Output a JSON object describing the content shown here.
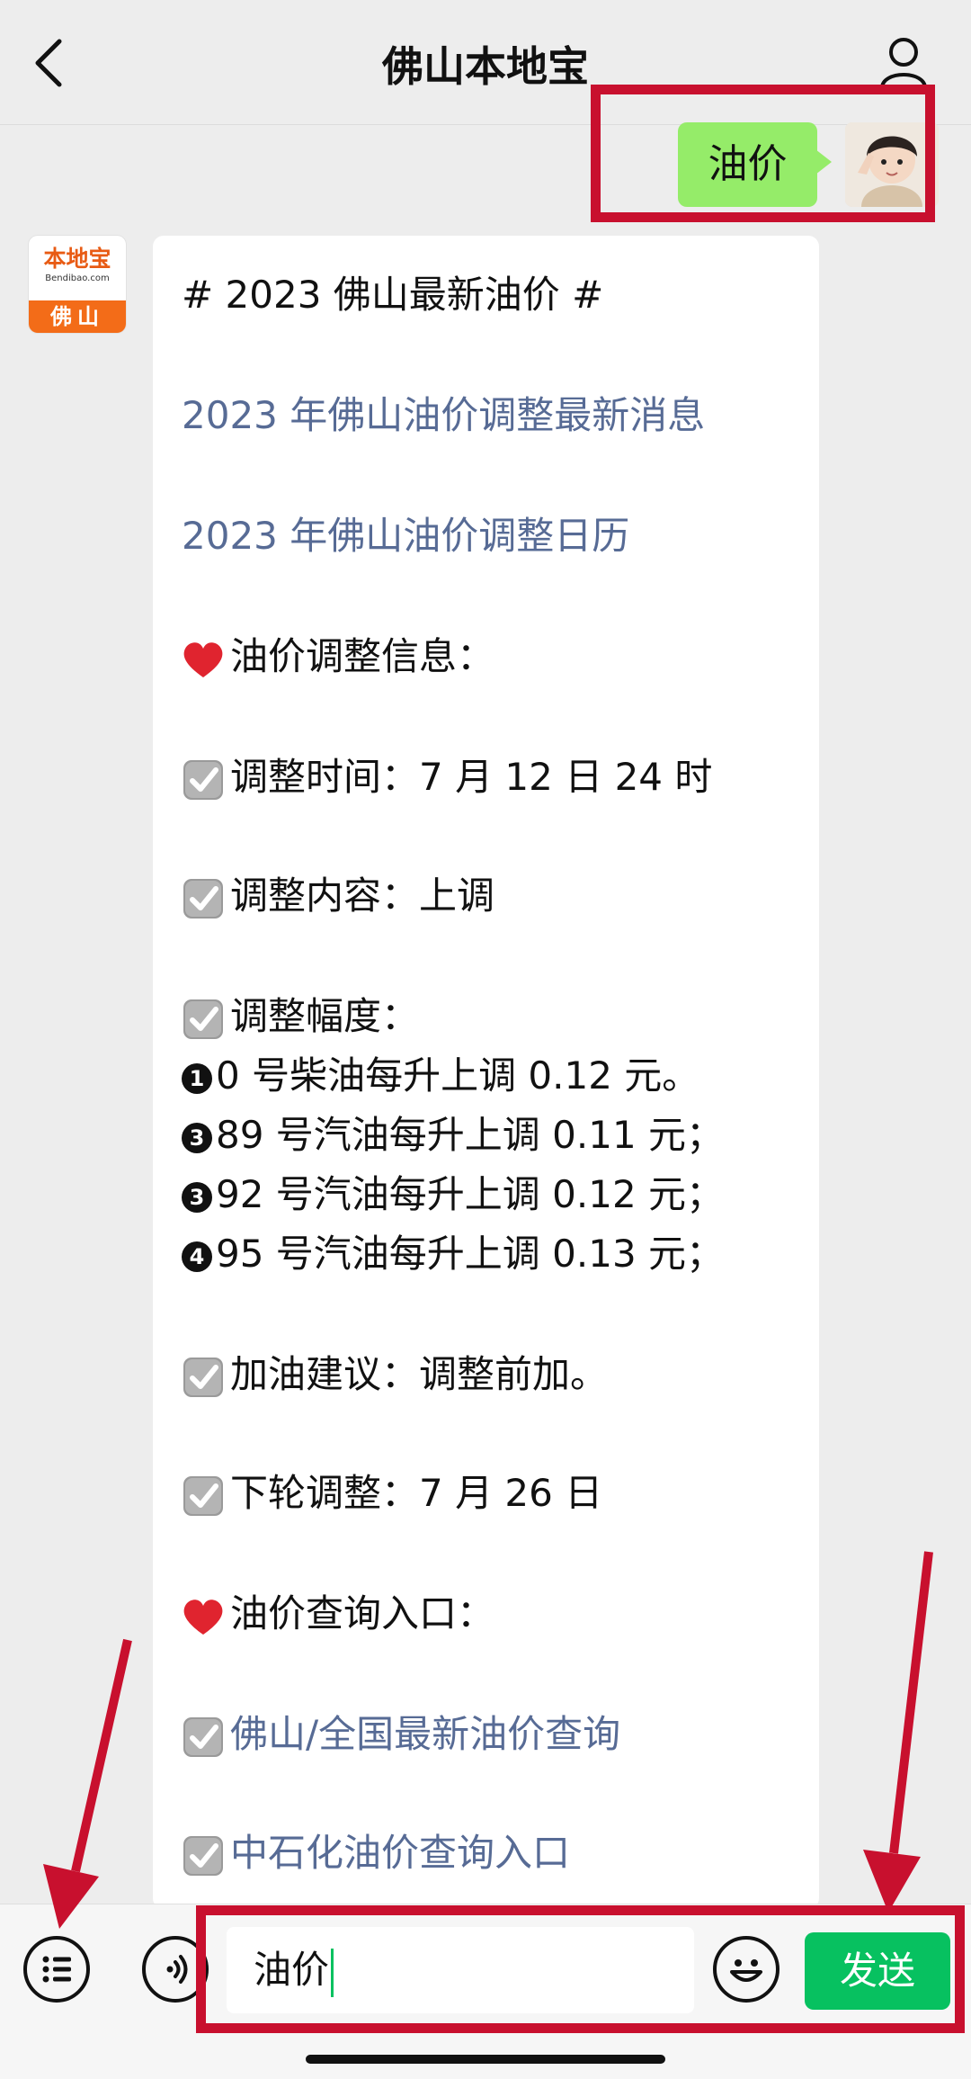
{
  "header": {
    "title": "佛山本地宝",
    "back_icon": "chevron-left-icon",
    "profile_icon": "person-icon"
  },
  "outgoing": {
    "text": "油价"
  },
  "bot": {
    "logo_text": "本地宝",
    "logo_sub": "Bendibao.com",
    "city": "佛山"
  },
  "message": {
    "lines": [
      {
        "type": "text",
        "text": "# 2023 佛山最新油价 #"
      },
      {
        "type": "link",
        "text": "2023 年佛山油价调整最新消息"
      },
      {
        "type": "link",
        "text": "2023 年佛山油价调整日历"
      },
      {
        "type": "heart",
        "text": "油价调整信息："
      },
      {
        "type": "check",
        "text": "调整时间：7 月 12 日 24 时"
      },
      {
        "type": "check",
        "text": "调整内容：上调"
      },
      {
        "type": "check",
        "text": "调整幅度："
      },
      {
        "type": "numbered",
        "num": "1",
        "text": "0 号柴油每升上调 0.12 元。"
      },
      {
        "type": "numbered",
        "num": "3",
        "text": "89 号汽油每升上调 0.11 元；"
      },
      {
        "type": "numbered",
        "num": "3",
        "text": "92 号汽油每升上调 0.12 元；"
      },
      {
        "type": "numbered",
        "num": "4",
        "text": "95 号汽油每升上调 0.13 元；"
      },
      {
        "type": "check",
        "text": "加油建议：调整前加。"
      },
      {
        "type": "check",
        "text": "下轮调整：7 月 26 日"
      },
      {
        "type": "heart",
        "text": "油价查询入口："
      },
      {
        "type": "check-link",
        "text": "佛山/全国最新油价查询"
      },
      {
        "type": "check-link",
        "text": "中石化油价查询入口"
      }
    ]
  },
  "input_bar": {
    "input_value": "油价",
    "send_label": "发送",
    "menu_icon": "list-icon",
    "voice_icon": "voice-icon",
    "emoji_icon": "smiley-icon"
  },
  "colors": {
    "accent": "#07c160",
    "bubble_out": "#95ec69",
    "link": "#576b95",
    "annotation": "#c8102e"
  }
}
